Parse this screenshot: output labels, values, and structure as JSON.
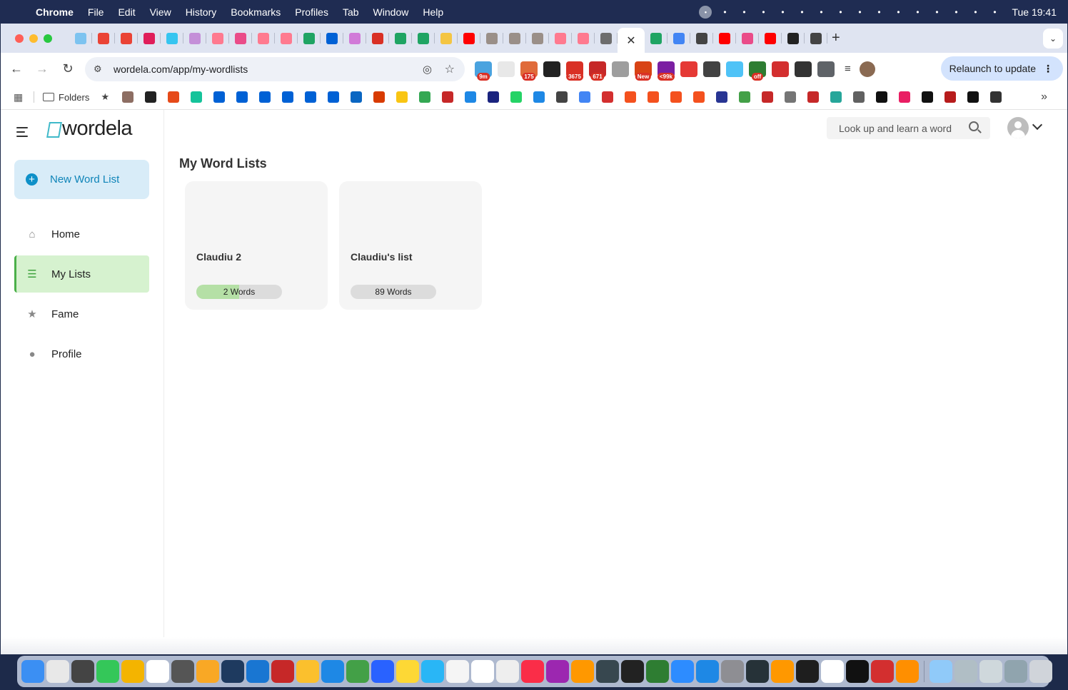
{
  "menubar": {
    "app_name": "Chrome",
    "menus": [
      "File",
      "Edit",
      "View",
      "History",
      "Bookmarks",
      "Profiles",
      "Tab",
      "Window",
      "Help"
    ],
    "status_icons": [
      "upwork-icon",
      "figma-icon",
      "notion-icon",
      "lotus-icon",
      "shield-icon",
      "display-icon",
      "time-machine-icon",
      "user-icon",
      "moon-icon",
      "play-icon",
      "bluetooth-icon",
      "battery-icon",
      "wifi-icon",
      "search-icon",
      "control-center-icon",
      "siri-icon"
    ],
    "time": "Tue 19:41"
  },
  "tabs": {
    "favicons": [
      {
        "name": "tab-favicon-app",
        "color": "#7dc3f0"
      },
      {
        "name": "tab-favicon-gmail",
        "color": "#ea4335"
      },
      {
        "name": "tab-favicon-gmail-2",
        "color": "#ea4335"
      },
      {
        "name": "tab-favicon-slack",
        "color": "#e01e5a"
      },
      {
        "name": "tab-favicon-slack-2",
        "color": "#36c5f0"
      },
      {
        "name": "tab-favicon-app-2",
        "color": "#c48fd8"
      },
      {
        "name": "tab-favicon-youtube",
        "color": "#ff7a8f"
      },
      {
        "name": "tab-favicon-dribbble",
        "color": "#ea4c89"
      },
      {
        "name": "tab-favicon-youtube-2",
        "color": "#ff7a8f"
      },
      {
        "name": "tab-favicon-youtube-3",
        "color": "#ff7a8f"
      },
      {
        "name": "tab-favicon-drive",
        "color": "#1fa463"
      },
      {
        "name": "tab-favicon-box",
        "color": "#0061d5"
      },
      {
        "name": "tab-favicon-app-3",
        "color": "#d17ad8"
      },
      {
        "name": "tab-favicon-target",
        "color": "#d93025"
      },
      {
        "name": "tab-favicon-drive-2",
        "color": "#1fa463"
      },
      {
        "name": "tab-favicon-drive-3",
        "color": "#1fa463"
      },
      {
        "name": "tab-favicon-sparkle",
        "color": "#f4c542"
      },
      {
        "name": "tab-favicon-youtube-4",
        "color": "#ff0000"
      },
      {
        "name": "tab-favicon-image",
        "color": "#9a8f88"
      },
      {
        "name": "tab-favicon-image-2",
        "color": "#9a8f88"
      },
      {
        "name": "tab-favicon-image-3",
        "color": "#9a8f88"
      },
      {
        "name": "tab-favicon-youtube-5",
        "color": "#ff7a8f"
      },
      {
        "name": "tab-favicon-youtube-6",
        "color": "#ff7a8f"
      },
      {
        "name": "tab-favicon-pen",
        "color": "#6d6d6d"
      }
    ],
    "active_close": "✕",
    "favicons_after": [
      {
        "name": "tab-favicon-drive-4",
        "color": "#1fa463"
      },
      {
        "name": "tab-favicon-docs",
        "color": "#4285f4"
      },
      {
        "name": "tab-favicon-openai",
        "color": "#444444"
      },
      {
        "name": "tab-favicon-youtube-7",
        "color": "#ff0000"
      },
      {
        "name": "tab-favicon-dribbble-2",
        "color": "#ea4c89"
      },
      {
        "name": "tab-favicon-youtube-8",
        "color": "#ff0000"
      },
      {
        "name": "tab-favicon-upwork",
        "color": "#222222"
      },
      {
        "name": "tab-favicon-openai-2",
        "color": "#444444"
      }
    ],
    "new_tab": "+"
  },
  "toolbar": {
    "url": "wordela.com/app/my-wordlists",
    "relaunch_label": "Relaunch to update",
    "extensions": [
      {
        "name": "ext-calendar",
        "color": "#4aa3df",
        "badge": "9m"
      },
      {
        "name": "ext-record",
        "color": "#e8e8e8",
        "badge": ""
      },
      {
        "name": "ext-briefcase",
        "color": "#e06b3a",
        "badge": "175"
      },
      {
        "name": "ext-font",
        "color": "#222222",
        "badge": ""
      },
      {
        "name": "ext-mail",
        "color": "#d93025",
        "badge": "3675"
      },
      {
        "name": "ext-headphones",
        "color": "#c62828",
        "badge": "671"
      },
      {
        "name": "ext-print",
        "color": "#9e9e9e",
        "badge": ""
      },
      {
        "name": "ext-new",
        "color": "#d84315",
        "badge": "New"
      },
      {
        "name": "ext-deals",
        "color": "#7b1fa2",
        "badge": "<99k"
      },
      {
        "name": "ext-opera",
        "color": "#e53935",
        "badge": ""
      },
      {
        "name": "ext-s",
        "color": "#424242",
        "badge": ""
      },
      {
        "name": "ext-hash",
        "color": "#4fc3f7",
        "badge": ""
      },
      {
        "name": "ext-off",
        "color": "#2e7d32",
        "badge": "off"
      },
      {
        "name": "ext-forward",
        "color": "#d32f2f",
        "badge": ""
      },
      {
        "name": "ext-ux",
        "color": "#333333",
        "badge": ""
      },
      {
        "name": "ext-puzzle",
        "color": "#5f6368",
        "badge": ""
      }
    ]
  },
  "bookmarks": {
    "folder_label": "Folders",
    "items": [
      {
        "name": "bookmark-1",
        "color": "#8d6e63"
      },
      {
        "name": "bookmark-2",
        "color": "#222222"
      },
      {
        "name": "bookmark-3",
        "color": "#e64a19"
      },
      {
        "name": "bookmark-grammarly",
        "color": "#15c39a"
      },
      {
        "name": "bookmark-box",
        "color": "#0061d5"
      },
      {
        "name": "bookmark-box-2",
        "color": "#0061d5"
      },
      {
        "name": "bookmark-box-3",
        "color": "#0061d5"
      },
      {
        "name": "bookmark-box-4",
        "color": "#0061d5"
      },
      {
        "name": "bookmark-box-5",
        "color": "#0061d5"
      },
      {
        "name": "bookmark-box-6",
        "color": "#0061d5"
      },
      {
        "name": "bookmark-linkedin",
        "color": "#0a66c2"
      },
      {
        "name": "bookmark-office",
        "color": "#d83b01"
      },
      {
        "name": "bookmark-yellow",
        "color": "#f9c513"
      },
      {
        "name": "bookmark-maps",
        "color": "#34a853"
      },
      {
        "name": "bookmark-nn",
        "color": "#c62828"
      },
      {
        "name": "bookmark-lines",
        "color": "#1e88e5"
      },
      {
        "name": "bookmark-dark",
        "color": "#1a237e"
      },
      {
        "name": "bookmark-whatsapp",
        "color": "#25d366"
      },
      {
        "name": "bookmark-play",
        "color": "#1e88e5"
      },
      {
        "name": "bookmark-openai",
        "color": "#444444"
      },
      {
        "name": "bookmark-gemini",
        "color": "#4285f4"
      },
      {
        "name": "bookmark-8",
        "color": "#d32f2f"
      },
      {
        "name": "bookmark-a",
        "color": "#f4511e"
      },
      {
        "name": "bookmark-a-2",
        "color": "#f4511e"
      },
      {
        "name": "bookmark-a-3",
        "color": "#f4511e"
      },
      {
        "name": "bookmark-a-4",
        "color": "#f4511e"
      },
      {
        "name": "bookmark-slash",
        "color": "#283593"
      },
      {
        "name": "bookmark-ring",
        "color": "#43a047"
      },
      {
        "name": "bookmark-tree",
        "color": "#c62828"
      },
      {
        "name": "bookmark-radial",
        "color": "#757575"
      },
      {
        "name": "bookmark-nn-2",
        "color": "#c62828"
      },
      {
        "name": "bookmark-download",
        "color": "#26a69a"
      },
      {
        "name": "bookmark-globe",
        "color": "#616161"
      },
      {
        "name": "bookmark-d",
        "color": "#111111"
      },
      {
        "name": "bookmark-m",
        "color": "#e91e63"
      },
      {
        "name": "bookmark-medium",
        "color": "#111111"
      },
      {
        "name": "bookmark-w",
        "color": "#b71c1c"
      },
      {
        "name": "bookmark-medium-2",
        "color": "#111111"
      },
      {
        "name": "bookmark-last",
        "color": "#333333"
      }
    ],
    "more": "»"
  },
  "sidebar": {
    "logo_text": "wordela",
    "new_list_label": "New Word List",
    "items": [
      {
        "label": "Home",
        "icon": "home-icon",
        "active": false
      },
      {
        "label": "My Lists",
        "icon": "list-icon",
        "active": true
      },
      {
        "label": "Fame",
        "icon": "star-icon",
        "active": false
      },
      {
        "label": "Profile",
        "icon": "person-icon",
        "active": false
      }
    ]
  },
  "header": {
    "search_placeholder": "Look up and learn a word"
  },
  "main": {
    "title": "My Word Lists",
    "lists": [
      {
        "name": "Claudiu 2",
        "count_label": "2 Words",
        "progress": 0.5
      },
      {
        "name": "Claudiu's list",
        "count_label": "89 Words",
        "progress": 0
      }
    ]
  },
  "colors": {
    "accent_green": "#4bb04a",
    "active_bg": "#d6f2cf",
    "new_list_bg": "#d8ecf8",
    "new_list_text": "#0e84b8"
  },
  "dock": {
    "apps": [
      {
        "name": "finder-icon",
        "color": "#3b8ff3"
      },
      {
        "name": "launchpad-icon",
        "color": "#e8e8e8"
      },
      {
        "name": "calculator-icon",
        "color": "#444444"
      },
      {
        "name": "facetime-icon",
        "color": "#34c759"
      },
      {
        "name": "app-ninja-icon",
        "color": "#f4b400"
      },
      {
        "name": "notion-icon",
        "color": "#ffffff"
      },
      {
        "name": "lotus-icon",
        "color": "#555555"
      },
      {
        "name": "photos-icon",
        "color": "#f9a825"
      },
      {
        "name": "quicktime-icon",
        "color": "#1e3a5f"
      },
      {
        "name": "app-compass-icon",
        "color": "#1976d2"
      },
      {
        "name": "app-red-icon",
        "color": "#c62828"
      },
      {
        "name": "stickies-icon",
        "color": "#fbc02d"
      },
      {
        "name": "app-store-icon",
        "color": "#1e88e5"
      },
      {
        "name": "cloud-icon",
        "color": "#43a047"
      },
      {
        "name": "shazam-icon",
        "color": "#2962ff"
      },
      {
        "name": "notes-icon",
        "color": "#fdd835"
      },
      {
        "name": "app-chart-icon",
        "color": "#29b6f6"
      },
      {
        "name": "reminders-icon",
        "color": "#f5f5f5"
      },
      {
        "name": "calendar-icon",
        "color": "#ffffff"
      },
      {
        "name": "textedit-icon",
        "color": "#eeeeee"
      },
      {
        "name": "music-icon",
        "color": "#fa2d48"
      },
      {
        "name": "podcasts-icon",
        "color": "#9c27b0"
      },
      {
        "name": "books-icon",
        "color": "#ff9800"
      },
      {
        "name": "resolve-icon",
        "color": "#37474f"
      },
      {
        "name": "chatgpt-icon",
        "color": "#222222"
      },
      {
        "name": "numbers-icon",
        "color": "#2e7d32"
      },
      {
        "name": "zoom-icon",
        "color": "#2d8cff"
      },
      {
        "name": "keynote-icon",
        "color": "#1e88e5"
      },
      {
        "name": "settings-icon",
        "color": "#8e8e93"
      },
      {
        "name": "activity-monitor-icon",
        "color": "#263238"
      },
      {
        "name": "pages-icon",
        "color": "#ff9800"
      },
      {
        "name": "figma-icon",
        "color": "#1e1e1e"
      },
      {
        "name": "chrome-icon",
        "color": "#ffffff"
      },
      {
        "name": "upwork-icon",
        "color": "#111111"
      },
      {
        "name": "acrobat-icon",
        "color": "#d32f2f"
      },
      {
        "name": "vlc-icon",
        "color": "#ff8f00"
      },
      {
        "name": "app-doc-icon",
        "color": "#90caf9"
      },
      {
        "name": "preview-icon",
        "color": "#b0bec5"
      },
      {
        "name": "printer-icon",
        "color": "#cfd8dc"
      },
      {
        "name": "screen-icon",
        "color": "#90a4ae"
      },
      {
        "name": "trash-icon",
        "color": "#d0d4da"
      }
    ]
  }
}
